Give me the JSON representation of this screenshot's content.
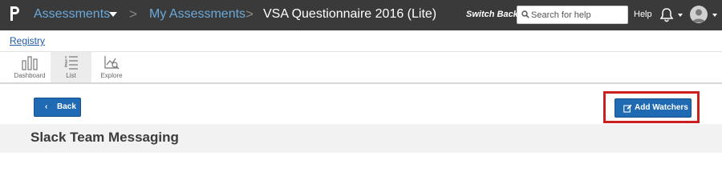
{
  "topbar": {
    "logo_icon": "p-logo-icon",
    "assessments": "Assessments",
    "separator": ">",
    "my_assessments": "My Assessments",
    "current": "VSA Questionnaire 2016 (Lite)",
    "switch_back": "Switch Back",
    "search_placeholder": "Search for help",
    "help": "Help",
    "bell_icon": "bell-icon",
    "avatar_icon": "user-avatar-icon"
  },
  "subheader": {
    "registry_link": "Registry"
  },
  "views": [
    {
      "label": "Dashboard",
      "icon": "bar-chart-icon"
    },
    {
      "label": "List",
      "icon": "list-icon",
      "active": true
    },
    {
      "label": "Explore",
      "icon": "explore-chart-icon"
    }
  ],
  "actions": {
    "back_label": "Back",
    "back_chevron": "‹",
    "add_watchers_label": "Add Watchers",
    "add_watchers_icon": "edit-icon",
    "highlight_color": "#cc1f1f"
  },
  "section": {
    "title": "Slack Team Messaging"
  },
  "colors": {
    "topbar": "#3a3a3a",
    "link_blue": "#6aa9dc",
    "button_blue": "#1f6ab3"
  }
}
